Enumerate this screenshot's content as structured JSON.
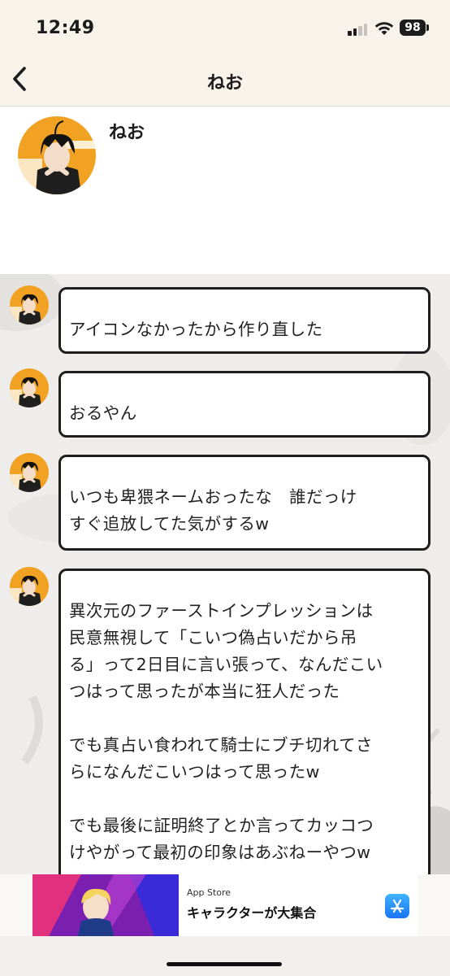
{
  "status_bar": {
    "time": "12:49",
    "battery": "98"
  },
  "nav": {
    "title": "ねお"
  },
  "profile": {
    "name": "ねお"
  },
  "messages": [
    {
      "text": "\nアイコンなかったから作り直した"
    },
    {
      "text": "\nおるやん"
    },
    {
      "text": "\nいつも卑猥ネームおったな　誰だっけ\nすぐ追放してた気がするw"
    },
    {
      "text": "\n異次元のファーストインプレッションは\n民意無視して「こいつ偽占いだから吊\nる」って2日目に言い張って、なんだこい\nつはって思ったが本当に狂人だった\n\nでも真占い食われて騎士にブチ切れてさ\nらになんだこいつはって思ったw\n\nでも最後に証明終了とか言ってカッコつ\nけやがって最初の印象はあぶねーやつw"
    }
  ],
  "ad": {
    "store": "App Store",
    "title": "キャラクターが大集合"
  },
  "colors": {
    "accent": "#f2a223",
    "bubble_border": "#1e1e1e",
    "header_bg": "#f8f3ea"
  }
}
